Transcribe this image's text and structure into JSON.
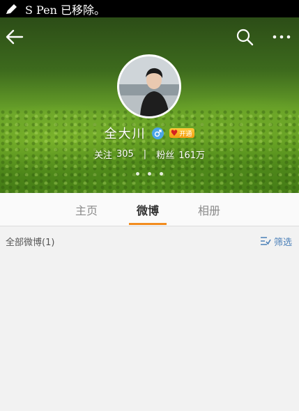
{
  "status_bar": {
    "notice": "S Pen 已移除。"
  },
  "profile": {
    "name": "全大川",
    "gender_icon": "male-icon",
    "badge_text": "开通",
    "stats": {
      "follow_label": "关注",
      "follow_count": "305",
      "separator": "|",
      "fans_label": "粉丝",
      "fans_count": "161万"
    }
  },
  "tabs": [
    {
      "label": "主页",
      "active": false
    },
    {
      "label": "微博",
      "active": true
    },
    {
      "label": "相册",
      "active": false
    }
  ],
  "posts": {
    "all_label": "全部微博(1)",
    "filter_label": "筛选"
  },
  "colors": {
    "accent": "#f28c1e",
    "link": "#4a7fb8",
    "gender": "#4ba5e8"
  }
}
